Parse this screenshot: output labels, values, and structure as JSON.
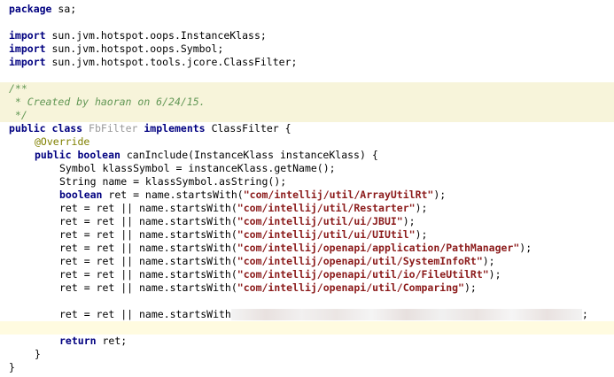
{
  "editor": {
    "package_kw": "package",
    "package_name": " sa;",
    "imports": [
      {
        "kw": "import",
        "path": " sun.jvm.hotspot.oops.InstanceKlass;"
      },
      {
        "kw": "import",
        "path": " sun.jvm.hotspot.oops.Symbol;"
      },
      {
        "kw": "import",
        "path": " sun.jvm.hotspot.tools.jcore.ClassFilter;"
      }
    ],
    "doc_open": "/**",
    "doc_body_prefix": " * ",
    "doc_body": "Created by haoran on 6/24/15.",
    "doc_close": " */",
    "class_decl": {
      "public": "public",
      "class": "class",
      "name": "FbFilter",
      "implements": "implements",
      "iface": "ClassFilter {"
    },
    "annotation": "@Override",
    "method_decl": {
      "public": "public",
      "boolean": "boolean",
      "rest": " canInclude(InstanceKlass instanceKlass) {"
    },
    "stmt_symbol": "Symbol klassSymbol = instanceKlass.getName();",
    "stmt_string": "String name = klassSymbol.asString();",
    "stmt_ret_kw": "boolean",
    "stmt_ret_rest": " ret = name.startsWith(",
    "stmt_ret_str": "\"com/intellij/util/ArrayUtilRt\"",
    "stmt_ret_end": ");",
    "or_prefix": "ret = ret || name.startsWith(",
    "or_lines": [
      "\"com/intellij/util/Restarter\"",
      "\"com/intellij/util/ui/JBUI\"",
      "\"com/intellij/util/ui/UIUtil\"",
      "\"com/intellij/openapi/application/PathManager\"",
      "\"com/intellij/openapi/util/SystemInfoRt\"",
      "\"com/intellij/openapi/util/io/FileUtilRt\"",
      "\"com/intellij/openapi/util/Comparing\""
    ],
    "or_end": ");",
    "redacted_prefix": "ret = ret || name.startsWith",
    "redacted_end": ";",
    "return_kw": "return",
    "return_rest": " ret;",
    "close_method": "}",
    "close_class": "}"
  }
}
